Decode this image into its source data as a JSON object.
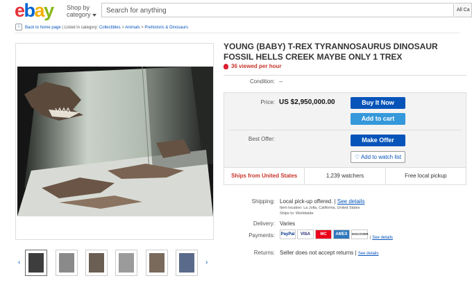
{
  "header": {
    "logo_letters": [
      "e",
      "b",
      "a",
      "y"
    ],
    "logo_colors": [
      "#e53238",
      "#0064d2",
      "#f5af02",
      "#86b817"
    ],
    "shop_by": "Shop by",
    "category": "category",
    "search_placeholder": "Search for anything",
    "category_select": "All Ca"
  },
  "breadcrumb": {
    "back": "Back to home page",
    "listed_in": "| Listed in category:",
    "items": [
      "Collectibles",
      "Animals",
      "Prehistoric & Dinosaurs"
    ],
    "separator": ">"
  },
  "item": {
    "title": "YOUNG (BABY) T-REX TYRANNOSAURUS DINOSAUR FOSSIL HELLS CREEK MAYBE ONLY 1 TREX",
    "viewed": "36 viewed per hour",
    "condition_label": "Condition:",
    "condition_value": "--",
    "price_label": "Price:",
    "price_value": "US $2,950,000.00",
    "buy_now": "Buy It Now",
    "add_to_cart": "Add to cart",
    "best_offer_label": "Best Offer:",
    "make_offer": "Make Offer",
    "watch_list": "Add to watch list",
    "ships_from": "Ships from United States",
    "watchers": "1,239 watchers",
    "pickup": "Free local pickup"
  },
  "details": {
    "shipping_label": "Shipping:",
    "shipping_value": "Local pick-up offered.",
    "see_details": "See details",
    "item_location": "Item location:  La Jolla, California, United States",
    "ships_to": "Ships to:  Worldwide",
    "delivery_label": "Delivery:",
    "delivery_value": "Varies",
    "payments_label": "Payments:",
    "payment_methods": [
      "PayPal",
      "VISA",
      "MC",
      "AMEX",
      "DISCOVER"
    ],
    "returns_label": "Returns:",
    "returns_value": "Seller does not accept returns"
  },
  "gallery": {
    "prev_arrow": "‹",
    "next_arrow": "›"
  }
}
